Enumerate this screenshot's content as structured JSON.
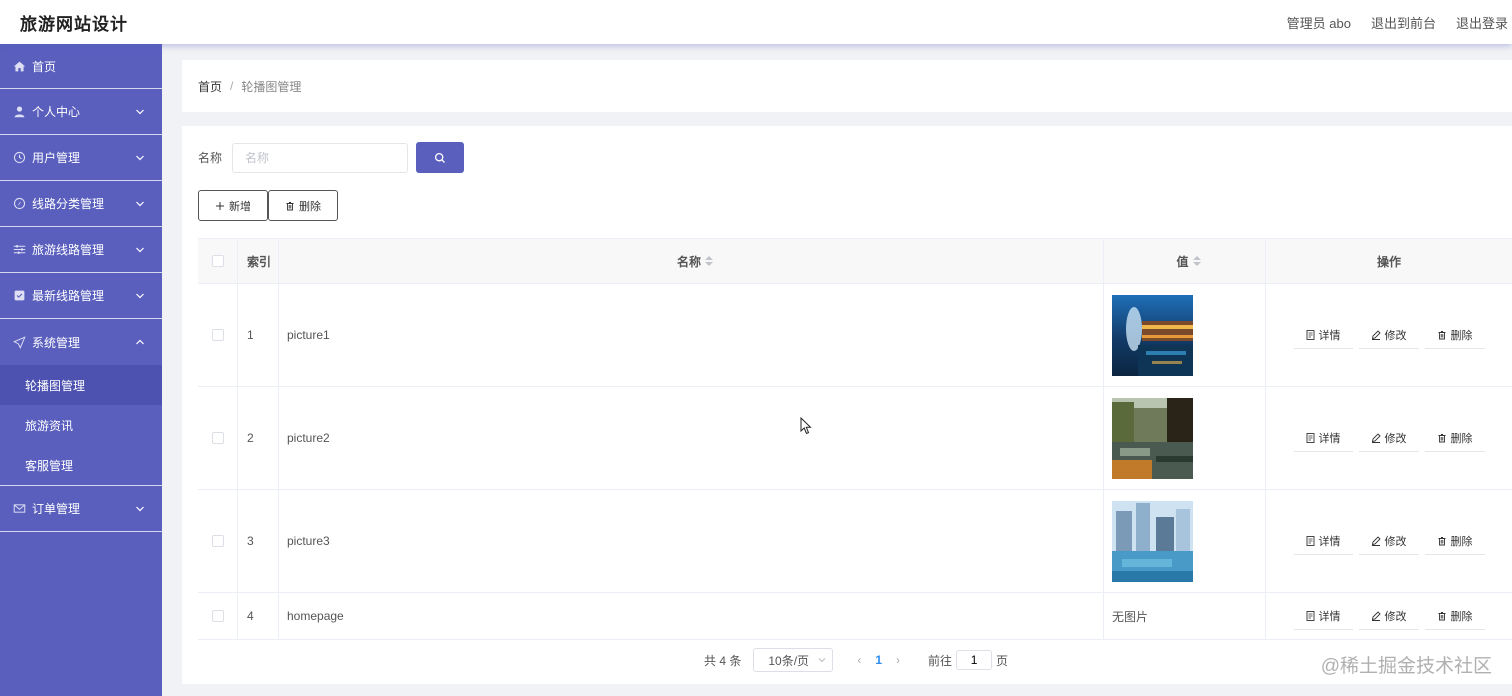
{
  "header": {
    "brand": "旅游网站设计",
    "admin": "管理员 abo",
    "to_front": "退出到前台",
    "logout": "退出登录"
  },
  "sidebar": {
    "items": [
      {
        "label": "首页",
        "icon": "home-icon"
      },
      {
        "label": "个人中心",
        "icon": "user-icon"
      },
      {
        "label": "用户管理",
        "icon": "clock-icon"
      },
      {
        "label": "线路分类管理",
        "icon": "compass-icon"
      },
      {
        "label": "旅游线路管理",
        "icon": "sliders-icon"
      },
      {
        "label": "最新线路管理",
        "icon": "checkbox-icon"
      },
      {
        "label": "系统管理",
        "icon": "send-icon"
      },
      {
        "label": "订单管理",
        "icon": "mail-icon"
      }
    ],
    "sub_items": [
      "轮播图管理",
      "旅游资讯",
      "客服管理"
    ]
  },
  "breadcrumb": {
    "home": "首页",
    "separator": "/",
    "current": "轮播图管理"
  },
  "search": {
    "label": "名称",
    "placeholder": "名称"
  },
  "toolbar": {
    "add_label": "新增",
    "delete_label": "删除"
  },
  "table": {
    "columns": [
      "索引",
      "名称",
      "值",
      "操作"
    ],
    "rows": [
      {
        "index": "1",
        "name": "picture1",
        "value": "",
        "image": "night-pool-photo"
      },
      {
        "index": "2",
        "name": "picture2",
        "value": "",
        "image": "canal-town-photo"
      },
      {
        "index": "3",
        "name": "picture3",
        "value": "",
        "image": "city-waterfront-photo"
      },
      {
        "index": "4",
        "name": "homepage",
        "value": "无图片",
        "image": ""
      }
    ],
    "actions": {
      "detail": "详情",
      "edit": "修改",
      "delete": "删除"
    }
  },
  "pagination": {
    "total": "共 4 条",
    "page_size": "10条/页",
    "current_page": "1",
    "goto_prefix": "前往",
    "goto_value": "1",
    "goto_suffix": "页"
  },
  "watermark": "@稀土掘金技术社区",
  "colors": {
    "primary": "#5a5fbe",
    "sidebar_active": "#4d52b0",
    "page_active": "#2d8cf0"
  }
}
